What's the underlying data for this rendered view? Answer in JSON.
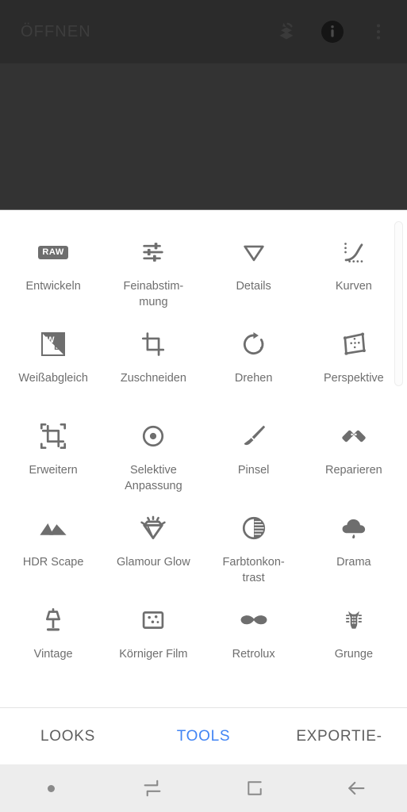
{
  "app": {
    "header": {
      "title": "ÖFFNEN",
      "icons": [
        {
          "name": "revert-layers-icon",
          "label": "Zurücksetzen"
        },
        {
          "name": "info-icon",
          "label": "Info"
        },
        {
          "name": "overflow-menu-icon",
          "label": "Mehr"
        }
      ]
    },
    "canvas": {
      "background_color": "#333333"
    },
    "tools": {
      "items": [
        {
          "label": "Entwickeln",
          "icon": "raw-badge-icon"
        },
        {
          "label": "Feinabstim-\nmung",
          "icon": "sliders-icon"
        },
        {
          "label": "Details",
          "icon": "triangle-down-icon"
        },
        {
          "label": "Kurven",
          "icon": "curves-icon"
        },
        {
          "label": "Weißabgleich",
          "icon": "white-balance-icon"
        },
        {
          "label": "Zuschneiden",
          "icon": "crop-icon"
        },
        {
          "label": "Drehen",
          "icon": "rotate-icon"
        },
        {
          "label": "Perspektive",
          "icon": "perspective-icon"
        },
        {
          "label": "Erweitern",
          "icon": "expand-icon"
        },
        {
          "label": "Selektive\nAnpassung",
          "icon": "selective-adjust-icon"
        },
        {
          "label": "Pinsel",
          "icon": "brush-icon"
        },
        {
          "label": "Reparieren",
          "icon": "healing-patch-icon"
        },
        {
          "label": "HDR Scape",
          "icon": "mountains-icon"
        },
        {
          "label": "Glamour\nGlow",
          "icon": "diamond-sparkle-icon"
        },
        {
          "label": "Farbtonkon-\ntrast",
          "icon": "tonal-contrast-icon"
        },
        {
          "label": "Drama",
          "icon": "cloud-rain-icon"
        },
        {
          "label": "Vintage",
          "icon": "lamp-icon"
        },
        {
          "label": "Körniger Film",
          "icon": "grain-square-icon"
        },
        {
          "label": "Retrolux",
          "icon": "mustache-icon"
        },
        {
          "label": "Grunge",
          "icon": "guitar-headstock-icon"
        }
      ]
    },
    "tabs": [
      {
        "label": "LOOKS",
        "active": false
      },
      {
        "label": "TOOLS",
        "active": true
      },
      {
        "label": "EXPORTIE-",
        "active": false
      }
    ],
    "navbar": {
      "buttons": [
        {
          "name": "nav-dot",
          "label": ""
        },
        {
          "name": "nav-switch-icon",
          "label": ""
        },
        {
          "name": "nav-home-square-icon",
          "label": ""
        },
        {
          "name": "nav-back-arrow-icon",
          "label": ""
        }
      ]
    },
    "colors": {
      "accent": "#4285f4",
      "topbar_bg": "#2b2b2b",
      "canvas_bg": "#333333",
      "icon_gray": "#6e6e6e",
      "label_gray": "#6e6e6e",
      "navbar_bg": "#ededed"
    }
  }
}
